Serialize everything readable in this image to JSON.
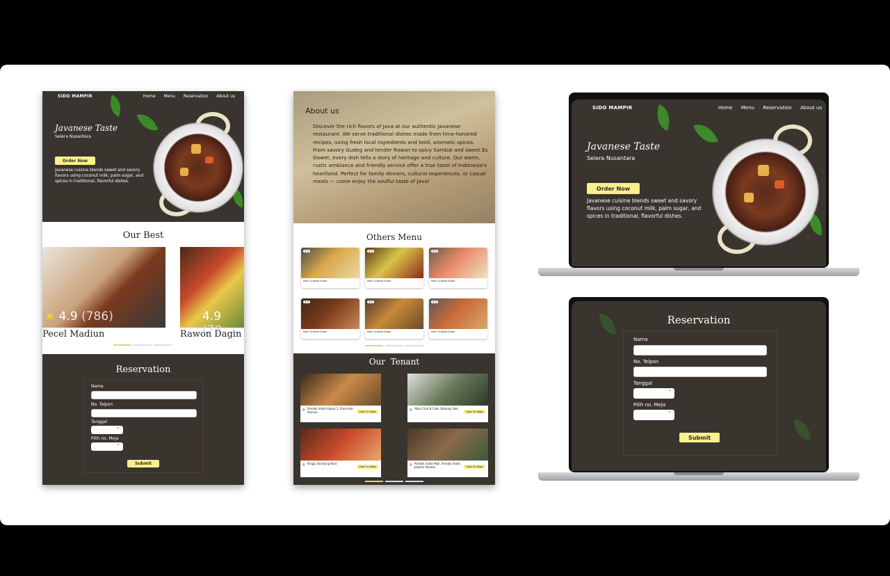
{
  "mobile": {
    "brand": "SIDO MAMPIR",
    "nav": [
      "Home",
      "Menu",
      "Reservation",
      "About us"
    ],
    "hero_title": "Javanese Taste",
    "hero_subtitle": "Selera Nusantara",
    "order_button": "Order Now",
    "hero_text": "Javanese cuisine blends sweet and savory flavors using coconut milk, palm sugar, and spices in traditional, flavorful dishes.",
    "best_title": "Our Best",
    "best_items": [
      {
        "name": "Pecel Madiun",
        "rating": "4.9",
        "count": "(786)"
      },
      {
        "name": "Rawon Dagin",
        "rating": "4.9",
        "count": "(78"
      }
    ],
    "reservation_title": "Reservation",
    "form": {
      "name_label": "Nama",
      "phone_label": "No. Telpon",
      "date_label": "Tanggal",
      "table_label": "Pilih no. Meja",
      "submit": "Submit"
    }
  },
  "middle": {
    "about_title": "About us",
    "about_text": "Discover the rich flavors of Java at our authentic Javanese restaurant. We serve traditional dishes made from time-honored recipes, using fresh local ingredients and bold, aromatic spices. From savory Gudeg and tender Rawon to spicy Sambal and sweet Es Dawet, every dish tells a story of heritage and culture. Our warm, rustic ambiance and friendly service offer a true taste of Indonesia's heartland. Perfect for family dinners, cultural experiences, or casual meals — come enjoy the soulful taste of Java!",
    "menu_title": "Others Menu",
    "menu_items": [
      {
        "caption": "Palm Cheese Edam",
        "badge": "4.9"
      },
      {
        "caption": "Palm Cheese Edam",
        "badge": "4.9"
      },
      {
        "caption": "Palm Cheese Edam",
        "badge": "4.9"
      },
      {
        "caption": "Palm Cheese Edam",
        "badge": "4.9"
      },
      {
        "caption": "Palm Cheese Edam",
        "badge": "4.9"
      },
      {
        "caption": "Palm Cheese Edam",
        "badge": "4.9"
      }
    ],
    "tenant_title": "Our  Tenant",
    "tenants": [
      {
        "address": "Pondok Indah Kapuk 2, Riverside Avenue",
        "map": "View On Maps"
      },
      {
        "address": "Atlas Club N Cafe, Badung, Bali",
        "map": "View On Maps"
      },
      {
        "address": "Braga, Bandung Kota",
        "map": "View On Maps"
      },
      {
        "address": "Pondok Indah Mall, Pondok Indah Jakarta Selatan",
        "map": "View On Maps"
      }
    ]
  },
  "laptop_top": {
    "brand": "SIDO MAMPIR",
    "nav": [
      "Home",
      "Menu",
      "Reservation",
      "About us"
    ],
    "hero_title": "Javanese Taste",
    "hero_subtitle": "Selera Nusantara",
    "order_button": "Order Now",
    "hero_text": "Javanese cuisine blends sweet and savory flavors using coconut milk, palm sugar, and spices in traditional, flavorful dishes."
  },
  "laptop_bottom": {
    "reservation_title": "Reservation",
    "form": {
      "name_label": "Nama",
      "phone_label": "No. Telpon",
      "date_label": "Tanggal",
      "table_label": "Pilih no. Meja",
      "submit": "Submit"
    }
  },
  "colors": {
    "dark_bg": "#39342e",
    "accent_yellow": "#f9ef8b",
    "leaf_green": "#3c8a2a"
  }
}
